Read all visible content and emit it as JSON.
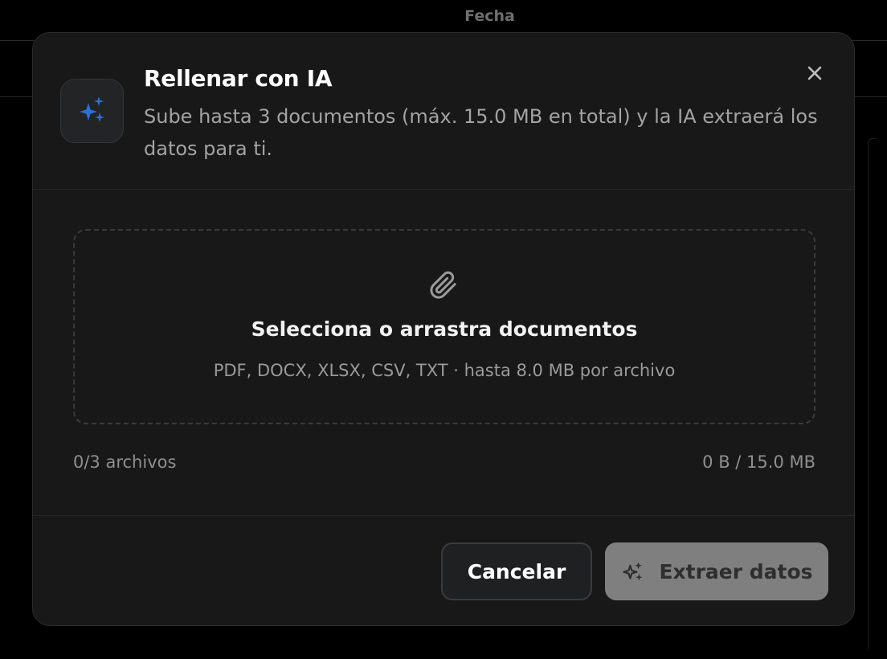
{
  "background": {
    "header_label": "Fecha"
  },
  "modal": {
    "icon": "sparkles-icon",
    "title": "Rellenar con IA",
    "subtitle": "Sube hasta 3 documentos (máx. 15.0 MB en total) y la IA extraerá los datos para ti.",
    "close_icon": "close-icon"
  },
  "dropzone": {
    "icon": "paperclip-icon",
    "title": "Selecciona o arrastra documentos",
    "hint": "PDF, DOCX, XLSX, CSV, TXT · hasta 8.0  MB por archivo"
  },
  "status": {
    "file_count": "0/3 archivos",
    "size_usage": "0 B / 15.0 MB"
  },
  "footer": {
    "cancel_label": "Cancelar",
    "extract_label": "Extraer datos",
    "extract_icon": "sparkles-icon"
  },
  "colors": {
    "accent": "#2f6fd6",
    "modal_bg": "#181818",
    "disabled_button": "#7f7f7f"
  }
}
